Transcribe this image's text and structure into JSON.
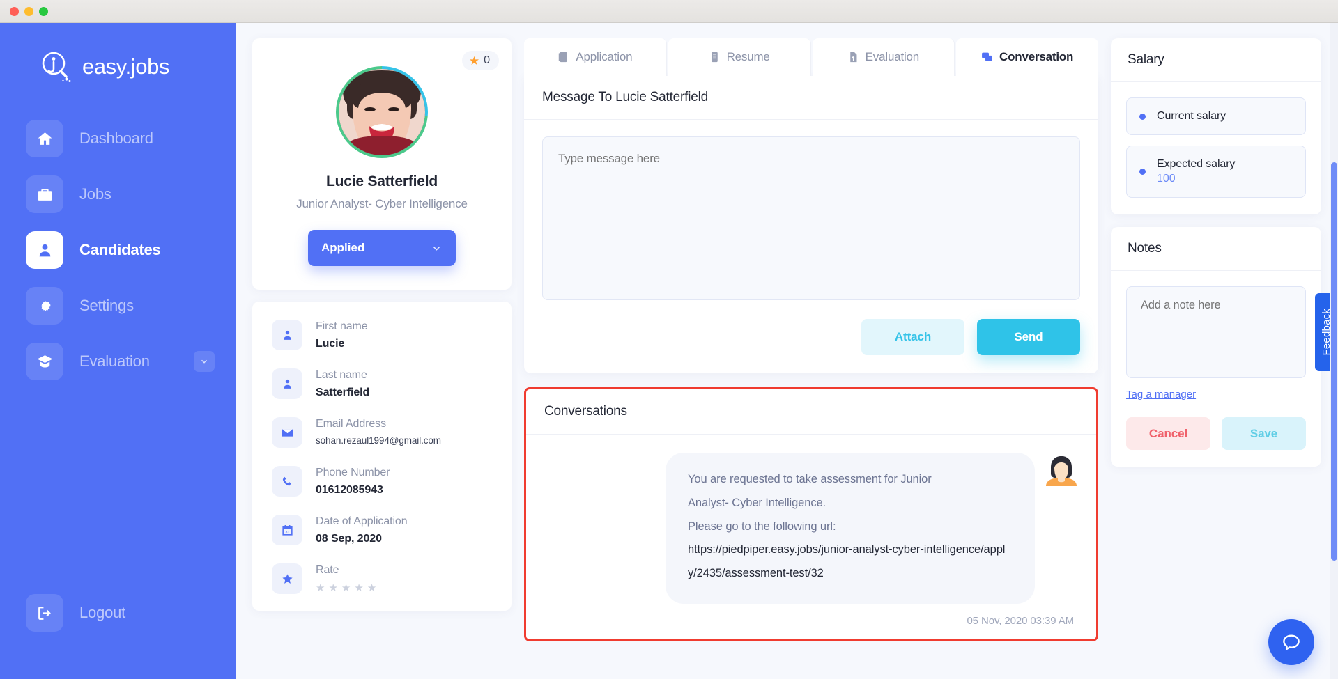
{
  "window": {
    "dots": [
      "close",
      "minimize",
      "zoom"
    ]
  },
  "sidebar": {
    "brand": "easy.jobs",
    "items": [
      {
        "label": "Dashboard",
        "icon": "home-icon",
        "active": false,
        "caret": false
      },
      {
        "label": "Jobs",
        "icon": "briefcase-icon",
        "active": false,
        "caret": false
      },
      {
        "label": "Candidates",
        "icon": "user-icon",
        "active": true,
        "caret": false
      },
      {
        "label": "Settings",
        "icon": "gear-icon",
        "active": false,
        "caret": false
      },
      {
        "label": "Evaluation",
        "icon": "graduation-cap-icon",
        "active": false,
        "caret": true
      }
    ],
    "logout": {
      "label": "Logout",
      "icon": "logout-icon"
    }
  },
  "profile": {
    "rating_badge": "0",
    "name": "Lucie Satterfield",
    "role": "Junior Analyst- Cyber Intelligence",
    "status": "Applied",
    "fields": [
      {
        "label": "First name",
        "value": "Lucie",
        "icon": "user-icon",
        "small": false
      },
      {
        "label": "Last name",
        "value": "Satterfield",
        "icon": "user-icon",
        "small": false
      },
      {
        "label": "Email Address",
        "value": "sohan.rezaul1994@gmail.com",
        "icon": "envelope-icon",
        "small": true
      },
      {
        "label": "Phone Number",
        "value": "01612085943",
        "icon": "phone-icon",
        "small": false
      },
      {
        "label": "Date of Application",
        "value": "08 Sep, 2020",
        "icon": "calendar-icon",
        "small": false
      },
      {
        "label": "Rate",
        "value": "",
        "icon": "star-icon",
        "stars": 5,
        "filled": 0,
        "small": false
      }
    ]
  },
  "tabs": [
    {
      "label": "Application",
      "icon": "document-icon",
      "active": false
    },
    {
      "label": "Resume",
      "icon": "resume-icon",
      "active": false
    },
    {
      "label": "Evaluation",
      "icon": "evaluation-icon",
      "active": false
    },
    {
      "label": "Conversation",
      "icon": "chat-icon",
      "active": true
    }
  ],
  "message": {
    "title": "Message To Lucie Satterfield",
    "placeholder": "Type message here",
    "value": "",
    "attach_label": "Attach",
    "send_label": "Send"
  },
  "conversations": {
    "title": "Conversations",
    "messages": [
      {
        "line1": "You are requested to take assessment for Junior",
        "line2": "Analyst- Cyber Intelligence.",
        "line3": "Please go to the following url:",
        "url": "https://piedpiper.easy.jobs/junior-analyst-cyber-intelligence/apply/2435/assessment-test/32",
        "timestamp": "05 Nov, 2020 03:39 AM"
      }
    ]
  },
  "salary": {
    "title": "Salary",
    "rows": [
      {
        "label": "Current salary",
        "value": ""
      },
      {
        "label": "Expected salary",
        "value": "100"
      }
    ]
  },
  "notes": {
    "title": "Notes",
    "placeholder": "Add a note here",
    "value": "",
    "tag_link": "Tag a manager",
    "cancel_label": "Cancel",
    "save_label": "Save"
  },
  "overlays": {
    "feedback_label": "Feedback",
    "help_icon": "chat-bubble-icon"
  },
  "colors": {
    "brand_blue": "#5170f5",
    "accent_cyan": "#2fc3e8",
    "danger_red": "#f03c30",
    "cancel_red": "#f0616b",
    "highlight_border": "#f03c30"
  }
}
